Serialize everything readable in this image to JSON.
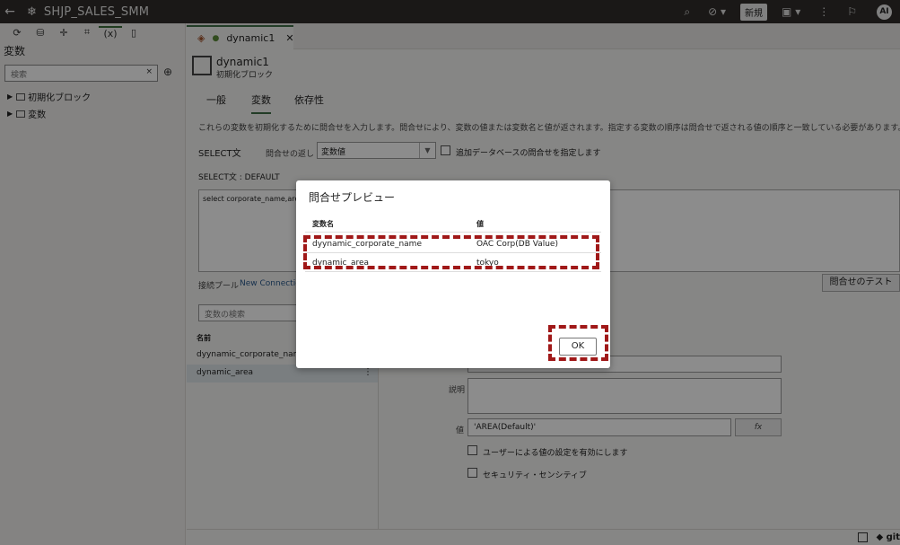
{
  "topbar": {
    "back_icon": "arrow-left-icon",
    "app_title": "SHJP_SALES_SMM",
    "new_label": "新規",
    "avatar_initials": "AI"
  },
  "left_panel": {
    "title": "変数",
    "search_placeholder": "検索",
    "search_clear": "×",
    "add_icon": "⊕",
    "tree": [
      {
        "label": "初期化ブロック"
      },
      {
        "label": "変数"
      }
    ]
  },
  "editor": {
    "tab_label": "dynamic1",
    "tab_close": "✕",
    "object_name": "dynamic1",
    "object_type": "初期化ブロック",
    "subtabs": [
      "一般",
      "変数",
      "依存性"
    ],
    "description": "これらの変数を初期化するために問合せを入力します。問合せにより、変数の値または変数名と値が返されます。指定する変数の順序は問合せで返される値の順序と一致している必要があります。",
    "select_label": "SELECT文",
    "query_return_label": "問合せの返し",
    "query_return_value": "変数値",
    "additional_db_label": "追加データベースの問合せを指定します",
    "select_default_label": "SELECT文 : DEFAULT",
    "sql_text": "select corporate_name,are",
    "conn_pool_label": "接続プール",
    "conn_pool_value": "New Connection",
    "test_button": "問合せのテスト",
    "var_search_placeholder": "変数の検索",
    "var_list_header": "名前",
    "variables": [
      "dyynamic_corporate_name",
      "dynamic_area"
    ],
    "desc_label": "説明",
    "value_label": "値",
    "value_field": "'AREA(Default)'",
    "fx_label": "fx",
    "user_setting_label": "ユーザーによる値の設定を有効にします",
    "security_label": "セキュリティ・センシティブ",
    "git_label": "git"
  },
  "dialog": {
    "title": "問合せプレビュー",
    "col_name": "変数名",
    "col_value": "値",
    "rows": [
      {
        "name": "dyynamic_corporate_name",
        "value": "OAC Corp(DB Value)"
      },
      {
        "name": "dynamic_area",
        "value": "tokyo"
      }
    ],
    "ok_label": "OK"
  },
  "colors": {
    "topbar_bg": "#312d2a",
    "accent_green": "#3f6e46",
    "highlight_red": "#a01818"
  }
}
